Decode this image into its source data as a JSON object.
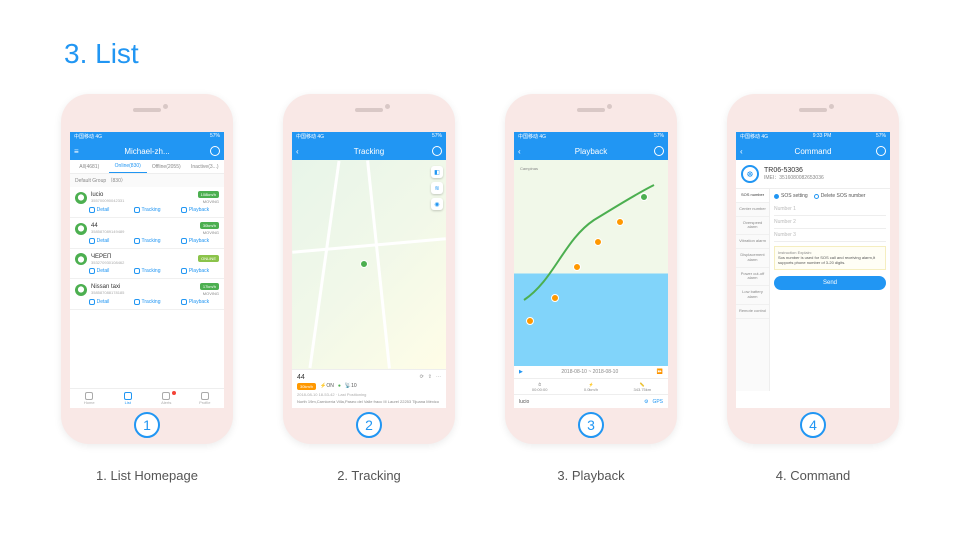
{
  "section_title": "3. List",
  "captions": [
    "1. List Homepage",
    "2. Tracking",
    "3. Playback",
    "4. Command"
  ],
  "statusbar": {
    "carrier": "中国移动 4G",
    "time": "9:33 PM",
    "battery": "57%"
  },
  "screens": {
    "list": {
      "header_title": "Michael-zh...",
      "tabs": [
        {
          "label": "All(4681)",
          "active": false
        },
        {
          "label": "Online(830)",
          "active": true
        },
        {
          "label": "Offline(2055)",
          "active": false
        },
        {
          "label": "Inactive(3...)",
          "active": false
        }
      ],
      "group": "Default Group （830）",
      "actions": [
        "Detail",
        "Tracking",
        "Playback"
      ],
      "devices": [
        {
          "name": "lucio",
          "imei": "355700090042331",
          "speed": "108km/h",
          "status": "MOVING",
          "badge_color": "#4caf50"
        },
        {
          "name": "44",
          "imei": "358587089149489",
          "speed": "30km/h",
          "status": "MOVING",
          "badge_color": "#4caf50"
        },
        {
          "name": "ЧЕРЕП",
          "imei": "353270930108462",
          "speed": "ONLINE",
          "status": "",
          "badge_color": "#8bc34a"
        },
        {
          "name": "Nissan taxi",
          "imei": "358587088178185",
          "speed": "17km/h",
          "status": "MOVING",
          "badge_color": "#4caf50"
        }
      ],
      "bottombar": [
        {
          "label": "Home",
          "active": false
        },
        {
          "label": "List",
          "active": true
        },
        {
          "label": "Alerts",
          "active": false,
          "dot": true
        },
        {
          "label": "Profile",
          "active": false
        }
      ]
    },
    "tracking": {
      "header_title": "Tracking",
      "device_name": "44",
      "badge": "30km/h",
      "acc_label": "ON",
      "switch": "ON",
      "sat": "10",
      "timestamp": "2018-08-10 18-53-42",
      "sub": "Last Positioning",
      "address": "North 19m,Carnicería Villa,Paseo del Valle fracc III Laurel 22253 Tijuana México"
    },
    "playback": {
      "header_title": "Playback",
      "date": "2018-08-10 ~ 2018-08-10",
      "stats": [
        {
          "value": "00:00:00",
          "label": ""
        },
        {
          "value": "0.0km/h",
          "label": ""
        },
        {
          "value": "343.75km",
          "label": ""
        }
      ],
      "device_name": "lucio",
      "right_links": [
        "",
        "GPS"
      ]
    },
    "command": {
      "header_title": "Command",
      "device_name": "TR06-53036",
      "imei_label": "IMEI：",
      "imei": "3516080082653036",
      "side_items": [
        "SOS number",
        "Center number",
        "Overspeed alarm",
        "Vibration alarm",
        "Displacement alarm",
        "Power cut-off alarm",
        "Low battery alarm",
        "Remote control"
      ],
      "radio": [
        "SOS setting",
        "Delete SOS number"
      ],
      "inputs": [
        "Number 1",
        "Number 2",
        "Number 3"
      ],
      "explain_title": "Instruction Explain:",
      "explain_body": "Sos number is used for SOS call and receiving alarm,It supports phone number of 3-20 digits.",
      "send": "Send"
    }
  }
}
